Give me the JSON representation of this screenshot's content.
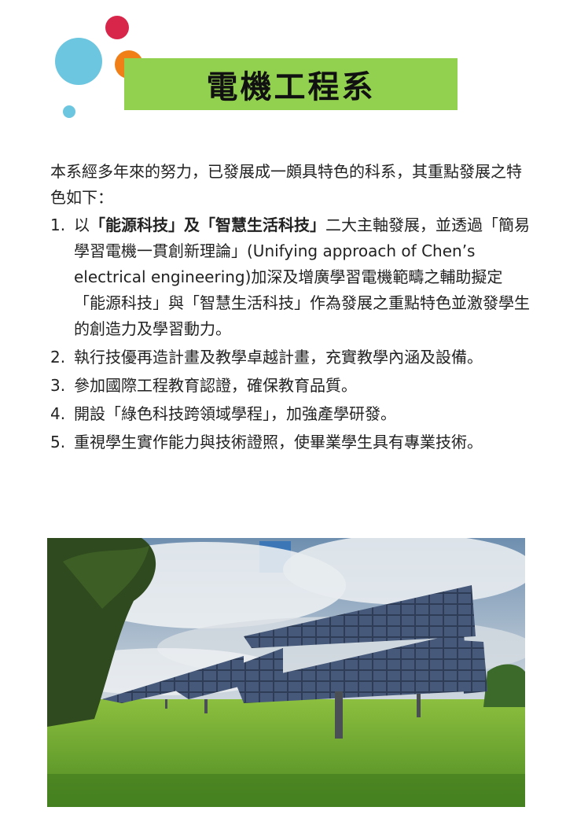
{
  "title": "電機工程系",
  "intro": "本系經多年來的努力，已發展成一頗具特色的科系，其重點發展之特色如下：",
  "items": [
    {
      "number": "1.",
      "prefix": "以",
      "bold": "「能源科技」及「智慧生活科技」",
      "text": "二大主軸發展，並透過「簡易學習電機一貫創新理論」(Unifying approach of Chen’s electrical engineering)加深及增廣學習電機範疇之輔助擬定「能源科技」與「智慧生活科技」作為發展之重點特色並激發學生的創造力及學習動力。"
    },
    {
      "number": "2.",
      "text": "執行技優再造計畫及教學卓越計畫，充實教學內涵及設備。"
    },
    {
      "number": "3.",
      "text": "參加國際工程教育認證，確保教育品質。"
    },
    {
      "number": "4.",
      "text": "開設「綠色科技跨領域學程」，加強產學研發。"
    },
    {
      "number": "5.",
      "text": "重視學生實作能力與技術證照，使畢業學生具有專業技術。"
    }
  ],
  "colors": {
    "title_bar": "#92d050",
    "dot_blue": "#6cc6df",
    "dot_red": "#d8254a",
    "dot_orange": "#f07f18"
  }
}
